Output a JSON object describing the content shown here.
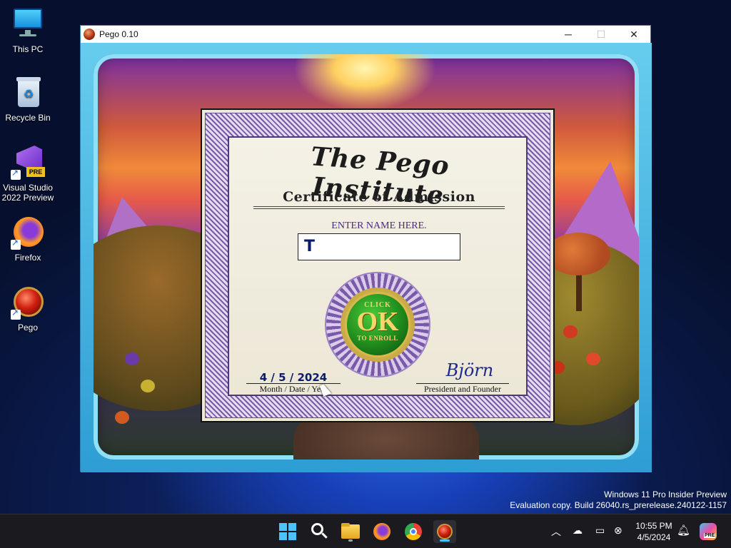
{
  "desktop": {
    "icons": [
      {
        "label": "This PC"
      },
      {
        "label": "Recycle Bin"
      },
      {
        "label": "Visual Studio 2022 Preview",
        "badge": "PRE"
      },
      {
        "label": "Firefox"
      },
      {
        "label": "Pego"
      }
    ]
  },
  "window": {
    "title": "Pego 0.10",
    "controls": {
      "minimize": "─",
      "maximize": "☐",
      "close": "✕"
    }
  },
  "certificate": {
    "title": "The Pego Institute",
    "subtitle": "Certificate of Admission",
    "enter_label": "ENTER NAME HERE.",
    "name_value": "T",
    "ok_top": "CLICK",
    "ok_main": "OK",
    "ok_bottom": "TO ENROLL",
    "date": "4 / 5 / 2024",
    "date_label": "Month / Date / Year",
    "signature": "Björn",
    "signature_label": "President and Founder"
  },
  "watermark": {
    "line1": "Windows 11 Pro Insider Preview",
    "line2": "Evaluation copy. Build 26040.rs_prerelease.240122-1157"
  },
  "taskbar": {
    "apps": [
      "start-icon",
      "search-icon",
      "file-explorer-icon",
      "firefox-icon",
      "chrome-icon",
      "pego-icon"
    ],
    "clock_time": "10:55 PM",
    "clock_date": "4/5/2024",
    "copilot_badge": "PRE"
  },
  "colors": {
    "taskbar_bg": "#1b1b1f",
    "accent": "#4cc2ff",
    "frame": "#6bd2f0",
    "certificate_purple": "#7a5aa8",
    "ok_green": "#1f8a1c"
  }
}
